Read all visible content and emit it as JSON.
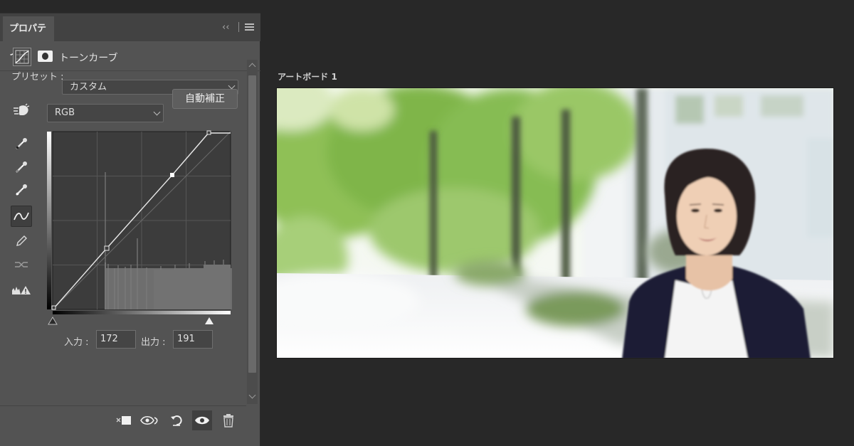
{
  "panel": {
    "tab_label": "プロパティ",
    "collapse_glyph": "‹‹",
    "adjustment_title": "トーンカーブ",
    "preset_label": "プリセット :",
    "preset_value": "カスタム",
    "channel_value": "RGB",
    "auto_button": "自動補正",
    "input_label": "入力 :",
    "input_value": "172",
    "output_label": "出力 :",
    "output_value": "191"
  },
  "canvas": {
    "artboard_label": "アートボード 1"
  },
  "icons": [
    "adjustment-layer-icon",
    "mask-icon",
    "target-adjust-icon",
    "black-eyedropper-icon",
    "gray-eyedropper-icon",
    "white-eyedropper-icon",
    "curve-point-icon",
    "pencil-icon",
    "smooth-icon",
    "clipping-warning-icon",
    "clip-to-layer-icon",
    "view-previous-icon",
    "reset-icon",
    "visibility-icon",
    "trash-icon"
  ],
  "colors": {
    "panel_bg": "#535353",
    "canvas_bg": "#282828",
    "accent_light": "#ffffff"
  }
}
